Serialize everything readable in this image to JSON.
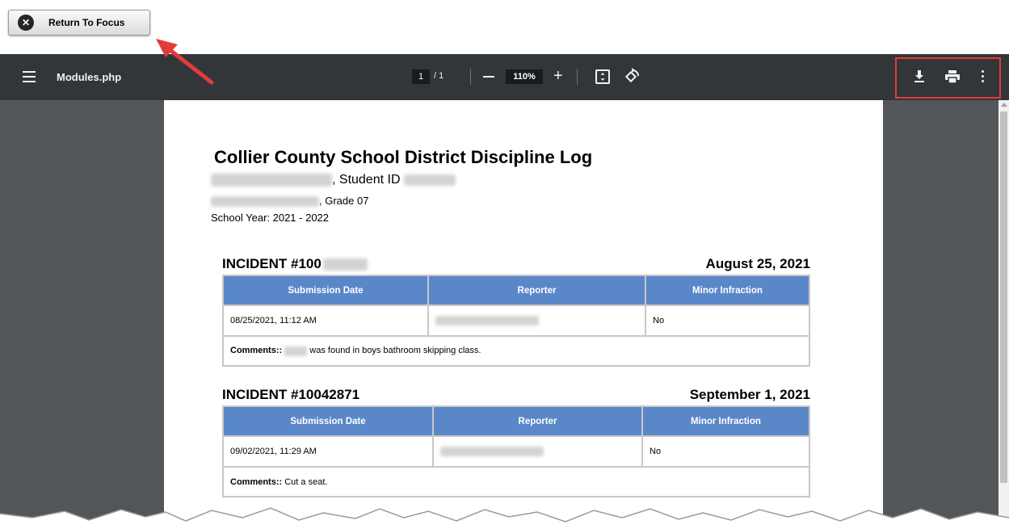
{
  "focus_button": {
    "label": "Return To Focus",
    "icon": "close-circle-icon"
  },
  "toolbar": {
    "title": "Modules.php",
    "page_current": "1",
    "page_total": "/ 1",
    "zoom": "110%",
    "icons": [
      "menu-icon",
      "zoom-out-icon",
      "zoom-in-icon",
      "fit-page-icon",
      "rotate-icon",
      "download-icon",
      "print-icon",
      "more-options-icon"
    ]
  },
  "document": {
    "title": "Collier County School District Discipline Log",
    "student_suffix": ", Student ID",
    "grade_suffix": ", Grade 07",
    "school_year": "School Year: 2021 - 2022",
    "columns": [
      "Submission Date",
      "Reporter",
      "Minor Infraction"
    ],
    "incidents": [
      {
        "heading": "INCIDENT #100",
        "date": "August 25, 2021",
        "submission_date": "08/25/2021, 11:12 AM",
        "minor_infraction": "No",
        "comments_label": "Comments::",
        "comments_text": "was found in boys bathroom skipping class."
      },
      {
        "heading": "INCIDENT #10042871",
        "date": "September 1, 2021",
        "submission_date": "09/02/2021, 11:29 AM",
        "minor_infraction": "No",
        "comments_label": "Comments::",
        "comments_text": "Cut a seat."
      }
    ]
  },
  "colors": {
    "toolbar_bg": "#323639",
    "viewer_bg": "#525659",
    "table_header": "#5a87c8",
    "highlight_box": "#e23b3b"
  }
}
